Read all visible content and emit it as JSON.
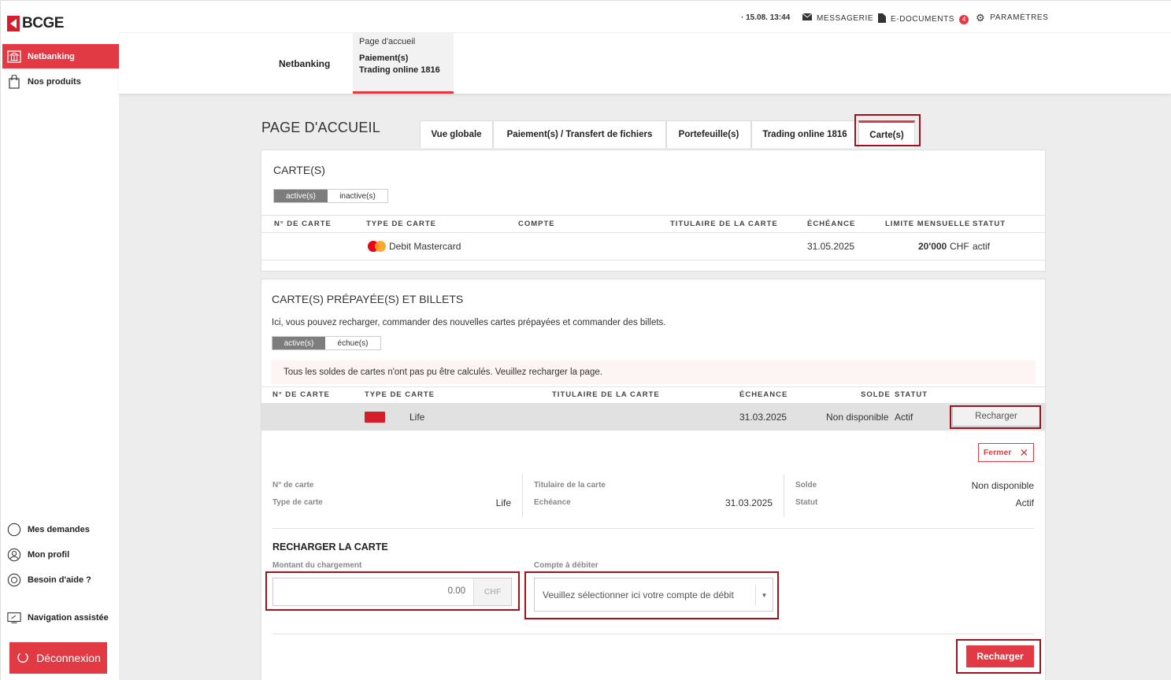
{
  "brand": {
    "name": "BCGE",
    "accent": "#e23a44"
  },
  "sidebar": {
    "items": [
      {
        "label": "Netbanking",
        "icon": "bank-icon"
      },
      {
        "label": "Nos produits",
        "icon": "shopping-bag-icon"
      }
    ],
    "bottom_items": [
      {
        "label": "Mes demandes",
        "icon": "chat-bubble-icon"
      },
      {
        "label": "Mon profil",
        "icon": "user-icon"
      },
      {
        "label": "Besoin d'aide ?",
        "icon": "lifebuoy-icon"
      },
      {
        "label": "Navigation assistée",
        "icon": "screen-share-icon"
      }
    ],
    "logout": "Déconnexion"
  },
  "topbar": {
    "datetime": "· 15.08. 13:44",
    "messagerie": "MESSAGERIE",
    "edocuments": "E-DOCUMENTS",
    "edocuments_badge": "4",
    "parametres": "PARAMÈTRES"
  },
  "navbar": {
    "netbanking": "Netbanking",
    "menu": [
      "Page d'accueil",
      "Paiement(s)",
      "Trading online 1816"
    ]
  },
  "main": {
    "title": "PAGE D'ACCUEIL",
    "tabs": [
      "Vue globale",
      "Paiement(s) / Transfert de fichiers",
      "Portefeuille(s)",
      "Trading online 1816",
      "Carte(s)"
    ],
    "active_tab": "Carte(s)"
  },
  "cards": {
    "title": "CARTE(S)",
    "filter": [
      "active(s)",
      "inactive(s)"
    ],
    "headers": [
      "N° DE CARTE",
      "TYPE DE CARTE",
      "COMPTE",
      "TITULAIRE DE LA CARTE",
      "ÉCHÉANCE",
      "LIMITE MENSUELLE",
      "STATUT"
    ],
    "rows": [
      {
        "number": "",
        "type": "Debit Mastercard",
        "account": "",
        "holder": "",
        "expiry": "31.05.2025",
        "limit": "20'000",
        "currency": "CHF",
        "status": "actif"
      }
    ]
  },
  "prepaid": {
    "title": "CARTE(S) PRÉPAYÉE(S) ET BILLETS",
    "intro": "Ici, vous pouvez recharger, commander des nouvelles cartes prépayées et commander des billets.",
    "filter": [
      "active(s)",
      "échue(s)"
    ],
    "notice": "Tous les soldes de cartes n'ont pas pu être calculés. Veuillez recharger la page.",
    "headers": [
      "N° DE CARTE",
      "TYPE DE CARTE",
      "TITULAIRE DE LA CARTE",
      "ÉCHEANCE",
      "SOLDE",
      "STATUT"
    ],
    "row": {
      "number": "",
      "type": "Life",
      "holder": "",
      "expiry": "31.03.2025",
      "balance": "Non disponible",
      "status": "Actif",
      "action": "Recharger"
    },
    "detail": {
      "close": "Fermer",
      "labels": {
        "number": "N° de carte",
        "type": "Type de carte",
        "holder": "Titulaire de la carte",
        "expiry": "Echéance",
        "balance": "Solde",
        "status": "Statut"
      },
      "values": {
        "number": "",
        "type": "Life",
        "holder": "",
        "expiry": "31.03.2025",
        "balance": "Non disponible",
        "status": "Actif"
      }
    },
    "reload": {
      "title": "RECHARGER LA CARTE",
      "amount_label": "Montant du chargement",
      "amount_placeholder": "0.00",
      "currency": "CHF",
      "account_label": "Compte à débiter",
      "account_placeholder": "Veuillez sélectionner ici votre compte de débit",
      "submit": "Recharger"
    }
  }
}
